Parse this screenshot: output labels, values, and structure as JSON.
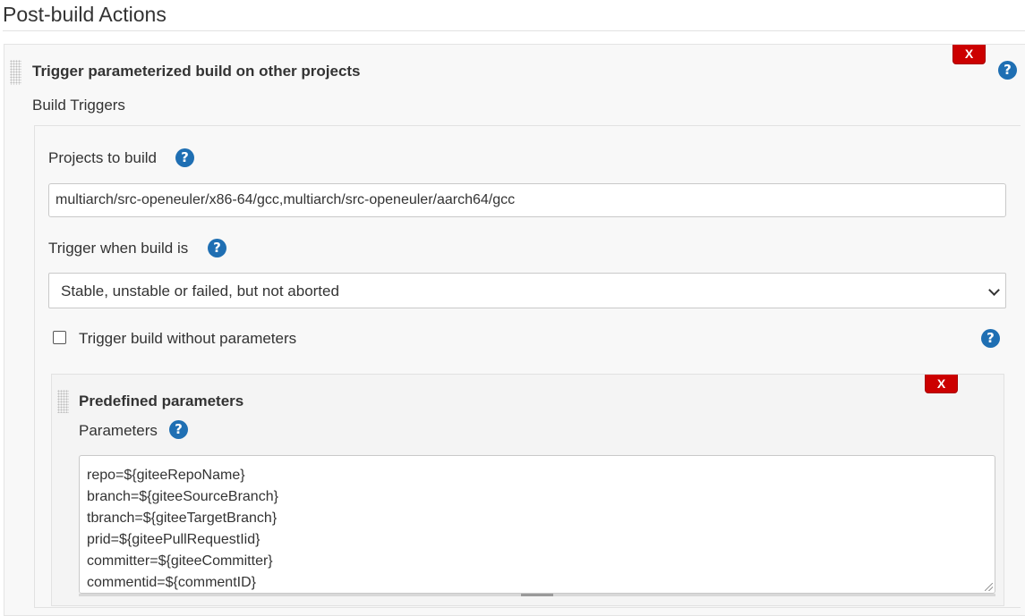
{
  "section": {
    "title": "Post-build Actions"
  },
  "trigger_block": {
    "title": "Trigger parameterized build on other projects",
    "delete_label": "X",
    "help_label": "?",
    "subheading": "Build Triggers"
  },
  "projects": {
    "label": "Projects to build",
    "help_label": "?",
    "value": "multiarch/src-openeuler/x86-64/gcc,multiarch/src-openeuler/aarch64/gcc"
  },
  "trigger_when": {
    "label": "Trigger when build is",
    "help_label": "?",
    "selected": "Stable, unstable or failed, but not aborted"
  },
  "without_params": {
    "label": "Trigger build without parameters",
    "checked": false,
    "help_label": "?"
  },
  "predefined": {
    "title": "Predefined parameters",
    "delete_label": "X",
    "params_label": "Parameters",
    "help_label": "?",
    "lines": [
      "repo=${giteeRepoName}",
      "branch=${giteeSourceBranch}",
      "tbranch=${giteeTargetBranch}",
      "prid=${giteePullRequestIid}",
      "committer=${giteeCommitter}",
      "commentid=${commentID}"
    ]
  },
  "colors": {
    "delete": "#cc0000",
    "help": "#1f6fb3",
    "panel": "#f8f8f8"
  },
  "icons": {
    "delete": "x-icon",
    "help": "question-mark-icon",
    "drag": "drag-handle-icon",
    "select": "chevron-down-icon"
  }
}
